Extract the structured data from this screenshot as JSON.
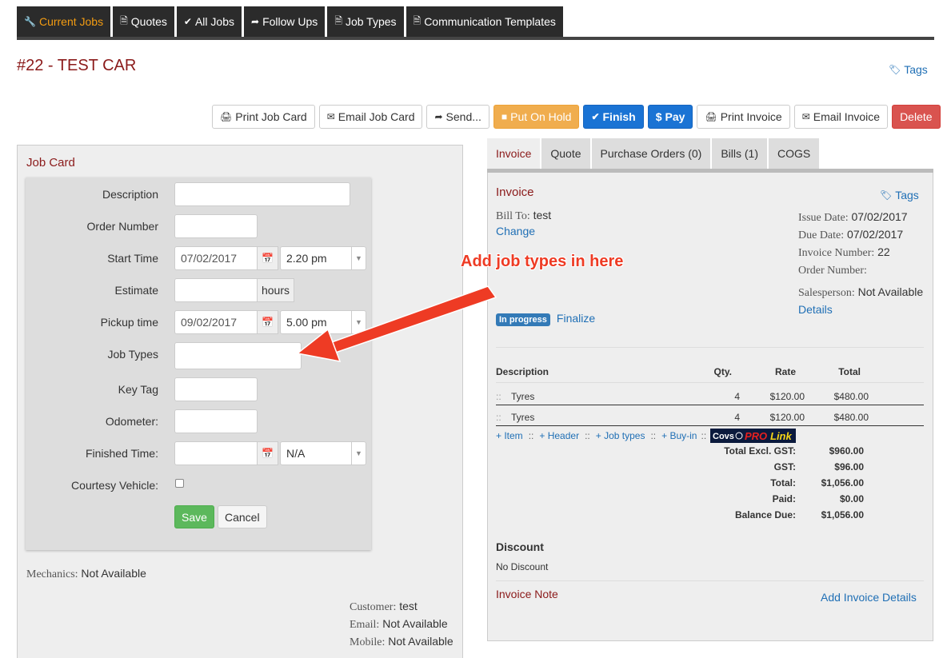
{
  "nav": {
    "tabs": [
      {
        "label": "Current Jobs",
        "icon": "wrench-icon"
      },
      {
        "label": "Quotes",
        "icon": "document-icon"
      },
      {
        "label": "All Jobs",
        "icon": "check-icon"
      },
      {
        "label": "Follow Ups",
        "icon": "share-icon"
      },
      {
        "label": "Job Types",
        "icon": "document-icon"
      },
      {
        "label": "Communication Templates",
        "icon": "document-icon"
      }
    ]
  },
  "page": {
    "title": "#22 - TEST CAR",
    "tags_label": "Tags"
  },
  "toolbar": {
    "print_job_card": "Print Job Card",
    "email_job_card": "Email Job Card",
    "send": "Send...",
    "put_on_hold": "Put On Hold",
    "finish": "Finish",
    "pay": "Pay",
    "print_invoice": "Print Invoice",
    "email_invoice": "Email Invoice",
    "delete": "Delete"
  },
  "job_card": {
    "title": "Job Card",
    "labels": {
      "description": "Description",
      "order_number": "Order Number",
      "start_time": "Start Time",
      "estimate": "Estimate",
      "pickup_time": "Pickup time",
      "job_types": "Job Types",
      "key_tag": "Key Tag",
      "odometer": "Odometer:",
      "finished_time": "Finished Time:",
      "courtesy_vehicle": "Courtesy Vehicle:"
    },
    "values": {
      "description": "",
      "order_number": "",
      "start_date": "07/02/2017",
      "start_time": "2.20 pm",
      "estimate": "",
      "estimate_unit": "hours",
      "pickup_date": "09/02/2017",
      "pickup_time": "5.00 pm",
      "job_types": "",
      "key_tag": "",
      "odometer": "",
      "finished_date": "",
      "finished_time": "N/A"
    },
    "save": "Save",
    "cancel": "Cancel",
    "mechanics_label": "Mechanics:",
    "mechanics_value": "Not Available",
    "customer_label": "Customer:",
    "customer_value": "test",
    "email_label": "Email:",
    "email_value": "Not Available",
    "mobile_label": "Mobile:",
    "mobile_value": "Not Available"
  },
  "invoice_tabs": [
    "Invoice",
    "Quote",
    "Purchase Orders (0)",
    "Bills (1)",
    "COGS"
  ],
  "invoice": {
    "title": "Invoice",
    "tags_label": "Tags",
    "bill_to_label": "Bill To:",
    "bill_to_value": "test",
    "change": "Change",
    "issue_date_label": "Issue Date:",
    "issue_date": "07/02/2017",
    "due_date_label": "Due Date:",
    "due_date": "07/02/2017",
    "invoice_number_label": "Invoice Number:",
    "invoice_number": "22",
    "order_number_label": "Order Number:",
    "salesperson_label": "Salesperson:",
    "salesperson": "Not Available",
    "details": "Details",
    "status_badge": "In progress",
    "finalize": "Finalize",
    "columns": [
      "Description",
      "Qty.",
      "Rate",
      "Total"
    ],
    "items": [
      {
        "desc": "Tyres",
        "qty": "4",
        "rate": "$120.00",
        "total": "$480.00"
      },
      {
        "desc": "Tyres",
        "qty": "4",
        "rate": "$120.00",
        "total": "$480.00"
      }
    ],
    "actions": {
      "item": "+ Item",
      "header": "+ Header",
      "job_types": "+ Job types",
      "buy_in": "+ Buy-in",
      "sep": "::"
    },
    "prolink_logo": "Covs PROLink",
    "totals": [
      {
        "label": "Total Excl. GST:",
        "value": "$960.00"
      },
      {
        "label": "GST:",
        "value": "$96.00"
      },
      {
        "label": "Total:",
        "value": "$1,056.00"
      },
      {
        "label": "Paid:",
        "value": "$0.00"
      },
      {
        "label": "Balance Due:",
        "value": "$1,056.00"
      }
    ],
    "discount_title": "Discount",
    "discount_value": "No Discount",
    "note_label": "Invoice Note",
    "add_details": "Add Invoice Details"
  },
  "annotation": {
    "text": "Add job types in here",
    "color": "#ee3b24"
  }
}
